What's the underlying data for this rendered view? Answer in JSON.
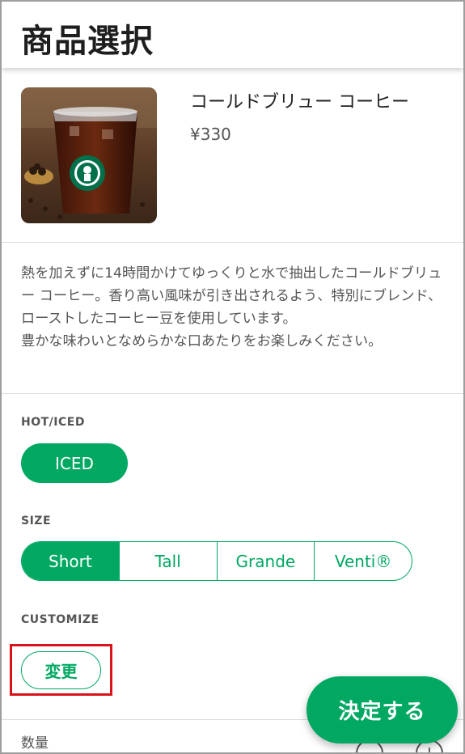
{
  "header": {
    "title": "商品選択"
  },
  "product": {
    "name": "コールドブリュー コーヒー",
    "price": "¥330",
    "image": "starbucks-cold-brew-cup"
  },
  "description": "熱を加えずに14時間かけてゆっくりと水で抽出したコールドブリュー コーヒー。香り高い風味が引き出されるよう、特別にブレンド、ローストしたコーヒー豆を使用しています。\n豊かな味わいとなめらかな口あたりをお楽しみください。",
  "hot_iced": {
    "label": "HOT/ICED",
    "value": "ICED"
  },
  "size": {
    "label": "SIZE",
    "options": [
      "Short",
      "Tall",
      "Grande",
      "Venti®"
    ],
    "selected": "Short"
  },
  "customize": {
    "label": "CUSTOMIZE",
    "button_label": "変更"
  },
  "quantity": {
    "label": "数量",
    "minus_icon": "minus-circle-icon",
    "plus_icon": "plus-circle-icon"
  },
  "confirm": {
    "label": "決定する"
  },
  "colors": {
    "accent": "#00a862",
    "highlight": "#d9131a"
  }
}
